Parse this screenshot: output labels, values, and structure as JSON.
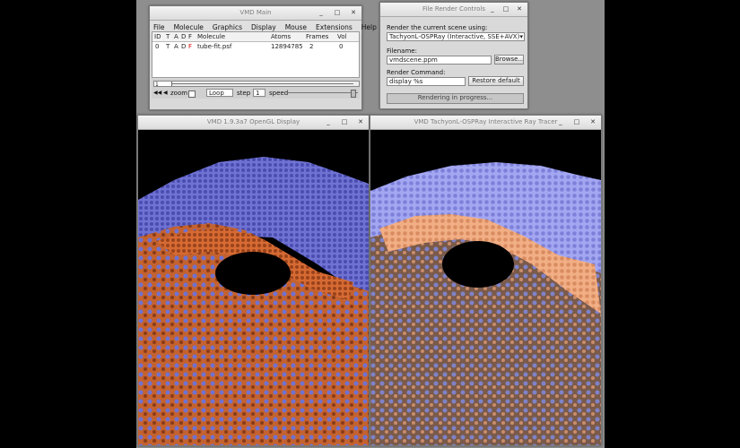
{
  "main_window": {
    "title": "VMD Main",
    "menu": [
      "File",
      "Molecule",
      "Graphics",
      "Display",
      "Mouse",
      "Extensions",
      "Help"
    ],
    "columns": [
      "ID",
      "T",
      "A",
      "D",
      "F",
      "Molecule",
      "Atoms",
      "Frames",
      "Vol"
    ],
    "molecules": [
      {
        "id": "0",
        "t": "T",
        "a": "A",
        "d": "D",
        "f": "F",
        "name": "tube-fit.psf",
        "atoms": "12894785",
        "frames": "2",
        "vol": "0"
      }
    ],
    "frame_value": "1",
    "zoom_label": "zoom",
    "mode_value": "Loop",
    "step_label": "step",
    "step_value": "1",
    "speed_label": "speed"
  },
  "render_window": {
    "title": "File Render Controls",
    "render_using_label": "Render the current scene using:",
    "renderer_value": "TachyonL-OSPRay (Interactive, SSE+AVX)",
    "filename_label": "Filename:",
    "filename_value": "vmdscene.ppm",
    "browse_label": "Browse...",
    "command_label": "Render Command:",
    "command_value": "display %s",
    "restore_label": "Restore default",
    "status_text": "Rendering in progress..."
  },
  "opengl_window": {
    "title": "VMD 1.9.3a7 OpenGL Display"
  },
  "tachyon_window": {
    "title": "VMD TachyonL-OSPRay Interactive Ray Tracer"
  },
  "colors": {
    "protein_orange": "#d66a33",
    "protein_blue": "#6f72d2",
    "ray_orange": "#f2ae84",
    "ray_blue": "#a3a7f2"
  }
}
